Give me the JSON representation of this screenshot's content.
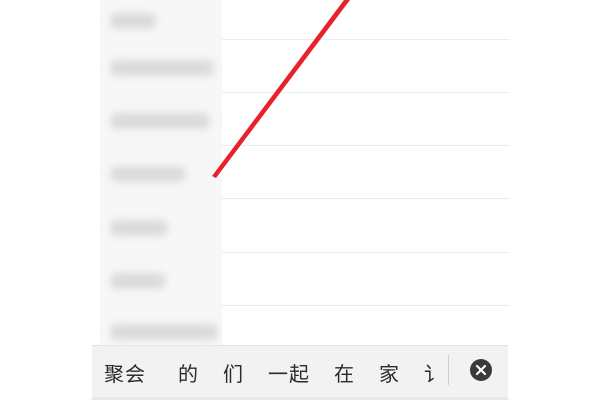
{
  "list": {
    "rows": [
      {
        "label_width": 46
      },
      {
        "label_width": 104
      },
      {
        "label_width": 100
      },
      {
        "label_width": 76
      },
      {
        "label_width": 58
      },
      {
        "label_width": 56
      },
      {
        "label_width": 108
      }
    ]
  },
  "suggestion_bar": {
    "items": [
      "聚会",
      "的",
      "们",
      "一起",
      "在",
      "家",
      "讠"
    ],
    "close_icon": "close-circle-icon"
  },
  "annotation": {
    "color": "#e8212b"
  }
}
